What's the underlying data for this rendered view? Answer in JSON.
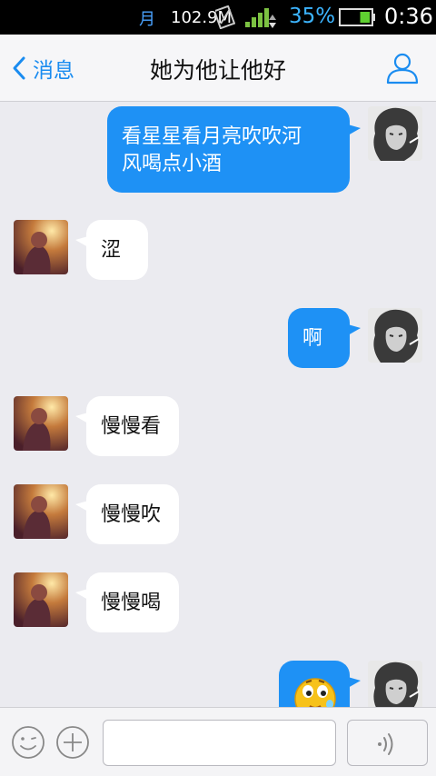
{
  "status_bar": {
    "moon_glyph": "月",
    "net_speed": "102.9M",
    "battery_percent": "35%",
    "time": "0:36",
    "battery_level": 0.35,
    "accent_color": "#3cb4ff"
  },
  "nav": {
    "back_label": "消息",
    "title": "她为他让他好",
    "accent_color": "#1a8cf0"
  },
  "messages": [
    {
      "side": "out",
      "text_line1": "看星星看月亮吹吹河",
      "text_line2": "风喝点小酒"
    },
    {
      "side": "in",
      "text": "涩"
    },
    {
      "side": "out",
      "text": "啊"
    },
    {
      "side": "in",
      "text": "慢慢看"
    },
    {
      "side": "in",
      "text": "慢慢吹"
    },
    {
      "side": "in",
      "text": "慢慢喝"
    },
    {
      "side": "out",
      "emoji": "drooling-face-emoji"
    }
  ],
  "input_bar": {
    "message_value": "",
    "icons": [
      "emoji-icon",
      "plus-icon",
      "voice-icon"
    ]
  },
  "colors": {
    "outgoing_bubble": "#1e91f5",
    "incoming_bubble": "#ffffff",
    "chat_background": "#ebebf0"
  }
}
